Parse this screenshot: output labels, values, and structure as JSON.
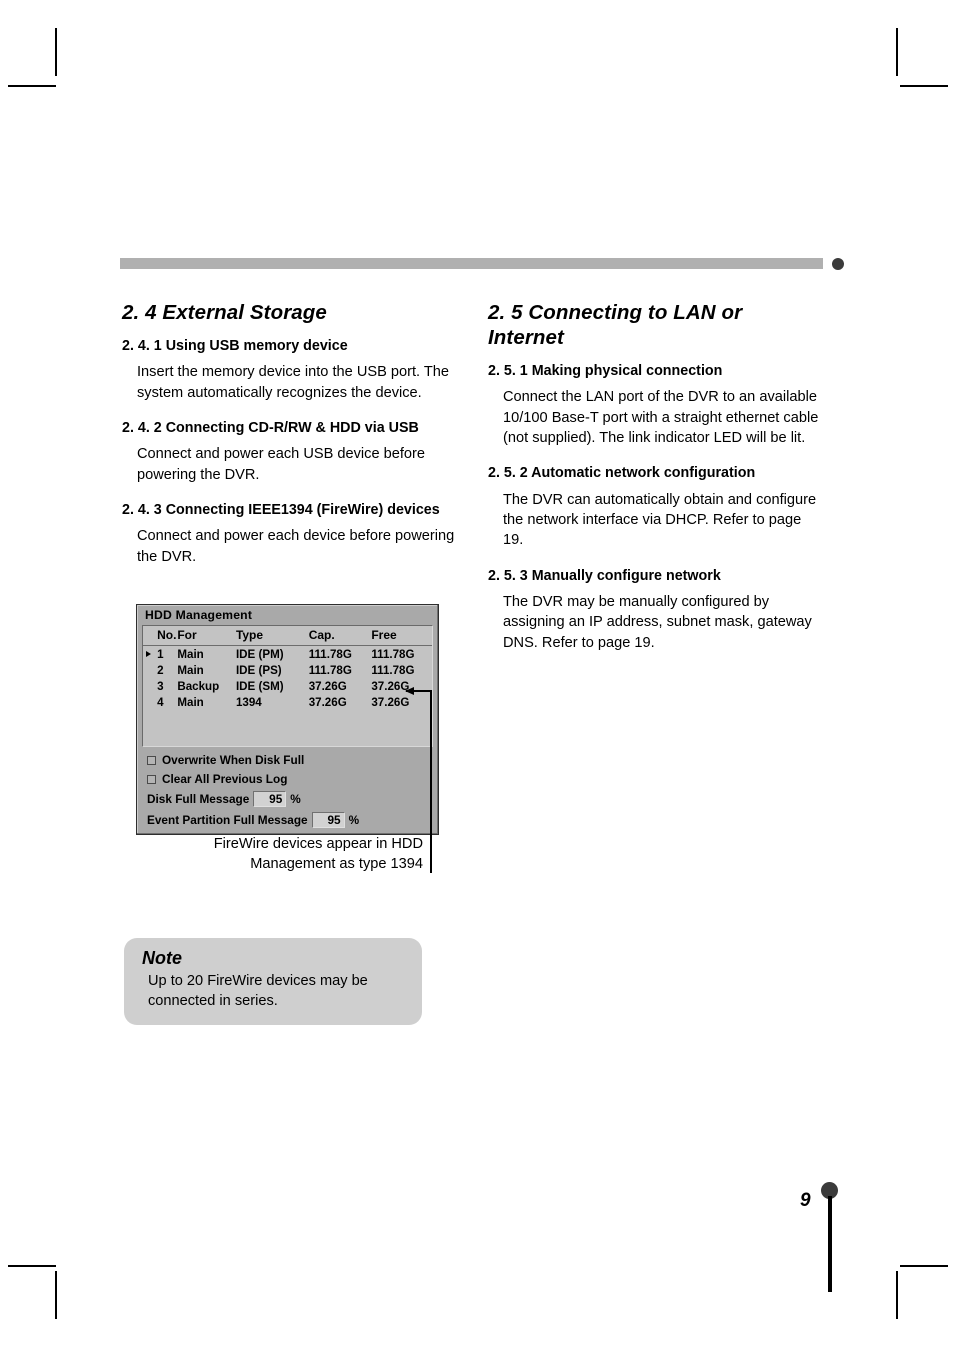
{
  "page": {
    "number": "9"
  },
  "left_column": {
    "heading": "2. 4 External Storage",
    "sections": [
      {
        "title": "2. 4. 1 Using USB memory device",
        "body": "Insert the memory device into the USB port. The system automatically recognizes the device."
      },
      {
        "title": "2. 4. 2 Connecting CD-R/RW & HDD via USB",
        "body": "Connect and power each USB device before powering the DVR."
      },
      {
        "title": "2. 4. 3 Connecting IEEE1394 (FireWire) devices",
        "body": "Connect and power each device before powering the DVR."
      }
    ]
  },
  "right_column": {
    "heading": "2. 5 Connecting to LAN or Internet",
    "sections": [
      {
        "title": "2. 5. 1 Making physical connection",
        "body": "Connect the LAN port of the DVR to an available 10/100 Base-T port with a straight ethernet cable (not supplied). The link indicator LED will be lit."
      },
      {
        "title": "2. 5. 2 Automatic network configuration",
        "body": "The DVR can automatically obtain and configure the network interface via DHCP. Refer to page 19."
      },
      {
        "title": "2. 5. 3 Manually configure network",
        "body": "The DVR may be manually configured by assigning an IP address, subnet mask, gateway DNS. Refer to page 19."
      }
    ]
  },
  "hdd_dialog": {
    "title": "HDD Management",
    "columns": [
      "No.",
      "For",
      "Type",
      "Cap.",
      "Free"
    ],
    "rows": [
      {
        "selected": true,
        "no": "1",
        "for": "Main",
        "type": "IDE (PM)",
        "cap": "111.78G",
        "free": "111.78G"
      },
      {
        "selected": false,
        "no": "2",
        "for": "Main",
        "type": "IDE (PS)",
        "cap": "111.78G",
        "free": "111.78G"
      },
      {
        "selected": false,
        "no": "3",
        "for": "Backup",
        "type": "IDE (SM)",
        "cap": "37.26G",
        "free": "37.26G"
      },
      {
        "selected": false,
        "no": "4",
        "for": "Main",
        "type": "1394",
        "cap": "37.26G",
        "free": "37.26G"
      }
    ],
    "options": {
      "overwrite_label": "Overwrite When Disk Full",
      "overwrite_checked": false,
      "clear_log_label": "Clear All Previous Log",
      "clear_log_checked": false,
      "disk_full_label": "Disk Full Message",
      "disk_full_value": "95",
      "disk_full_unit": "%",
      "event_partition_label": "Event Partition Full Message",
      "event_partition_value": "95",
      "event_partition_unit": "%"
    }
  },
  "figure_caption": "FireWire devices appear in HDD Management as type 1394",
  "note": {
    "title": "Note",
    "body": "Up to 20 FireWire devices may be connected in series."
  }
}
